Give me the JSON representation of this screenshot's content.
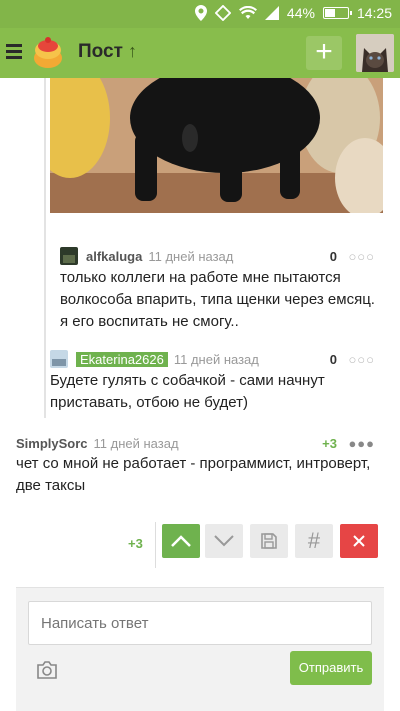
{
  "status_bar": {
    "battery": "44%",
    "time": "14:25",
    "battery_level": 0.44
  },
  "app_bar": {
    "title": "Пост"
  },
  "comments": [
    {
      "user": "alfkaluga",
      "time": "11 дней назад",
      "score": "0",
      "text": "только коллеги на работе мне пытаются волкособа впарить, типа щенки через емсяц. я его воспитать не смогу.."
    },
    {
      "user": "Ekaterina2626",
      "time": "11 дней назад",
      "score": "0",
      "text": "Будете гулять с собачкой - сами начнут приставать, отбою не будет)"
    },
    {
      "user": "SimplySorc",
      "time": "11 дней назад",
      "score": "+3",
      "text": "чет со мной не работает - программист, интроверт, две таксы"
    }
  ],
  "actions": {
    "score": "+3"
  },
  "reply": {
    "placeholder": "Написать ответ",
    "send_label": "Отправить"
  },
  "colors": {
    "accent": "#88bd4c",
    "vote_up": "#6fb24e",
    "close": "#e64545"
  }
}
